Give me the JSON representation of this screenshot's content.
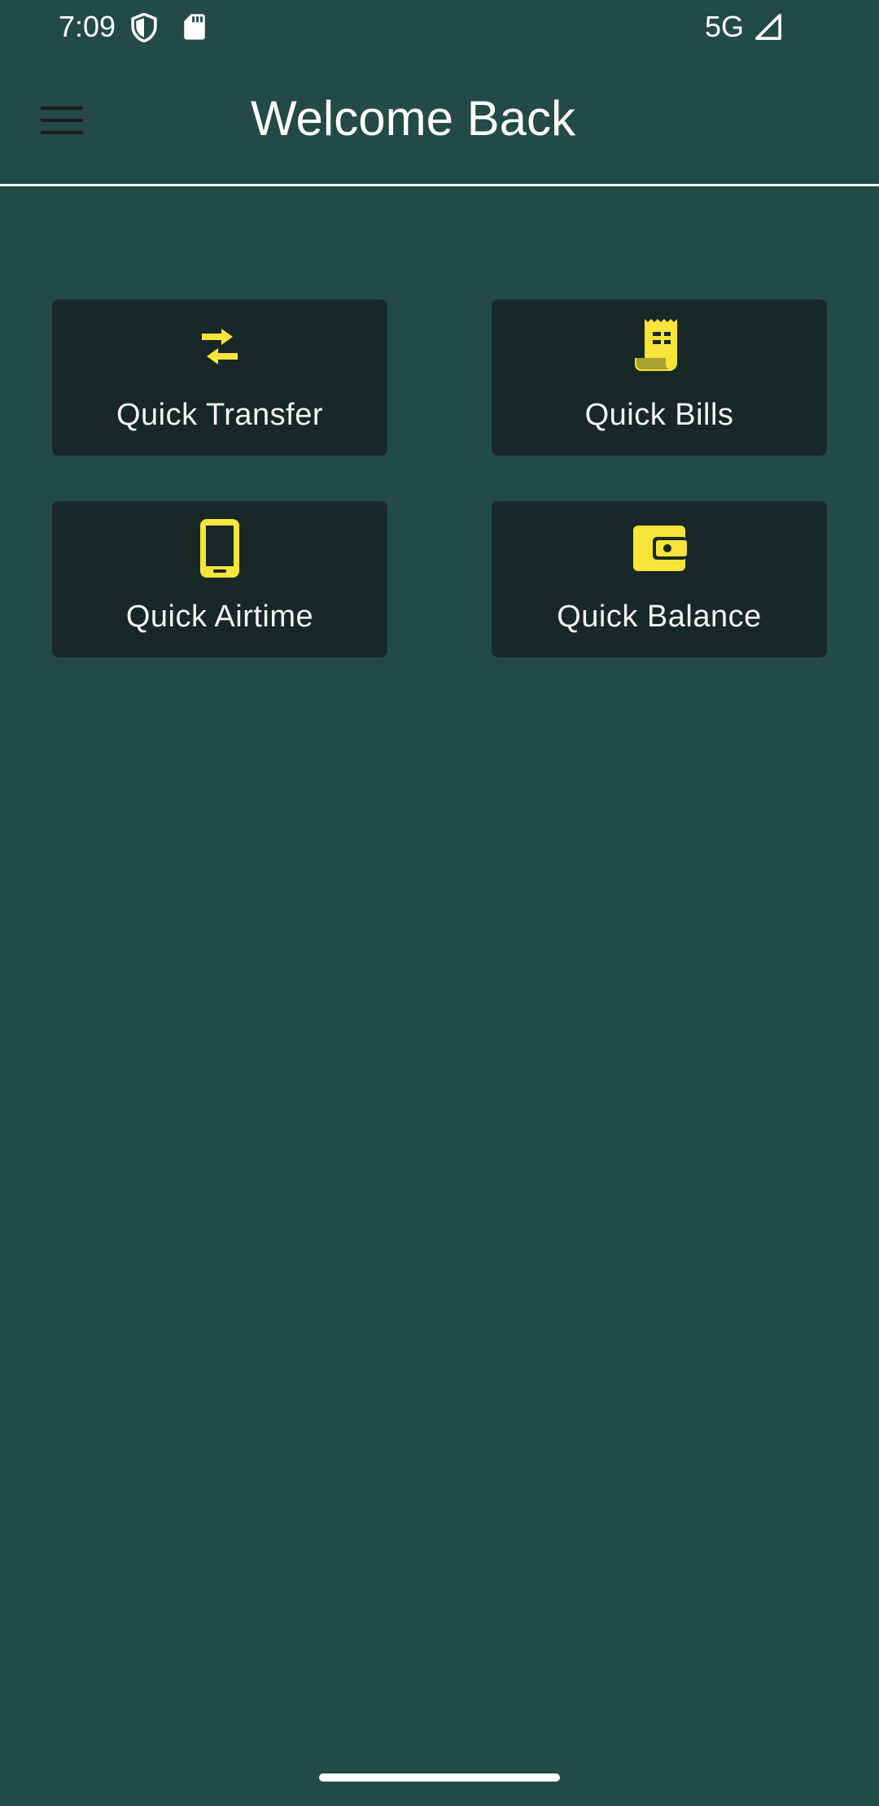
{
  "status_bar": {
    "time": "7:09",
    "network": "5G",
    "icons": [
      "shield-icon",
      "sd-card-icon",
      "signal-icon"
    ]
  },
  "app_bar": {
    "title": "Welcome Back",
    "menu_icon": "menu-icon"
  },
  "colors": {
    "background": "#234a47",
    "card": "#172826",
    "accent": "#f9e43a",
    "text": "#ffffff"
  },
  "quick_actions": [
    {
      "label": "Quick Transfer",
      "icon": "swap-arrows-icon"
    },
    {
      "label": "Quick Bills",
      "icon": "receipt-icon"
    },
    {
      "label": "Quick Airtime",
      "icon": "phone-icon"
    },
    {
      "label": "Quick Balance",
      "icon": "wallet-icon"
    }
  ]
}
